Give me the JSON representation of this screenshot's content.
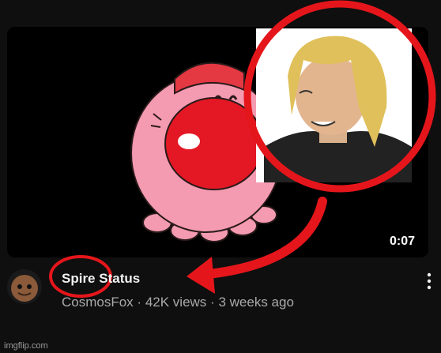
{
  "video": {
    "duration": "0:07",
    "title": "Spire Status",
    "channel": "CosmosFox",
    "views": "42K views",
    "age": "3 weeks ago",
    "separator": "·"
  },
  "icons": {
    "menu": "more-vert-icon",
    "avatar": "sackboy-avatar"
  },
  "annotations": {
    "circle_color": "#e5161b",
    "arrow_color": "#e5161b"
  },
  "watermark": "imgflip.com"
}
